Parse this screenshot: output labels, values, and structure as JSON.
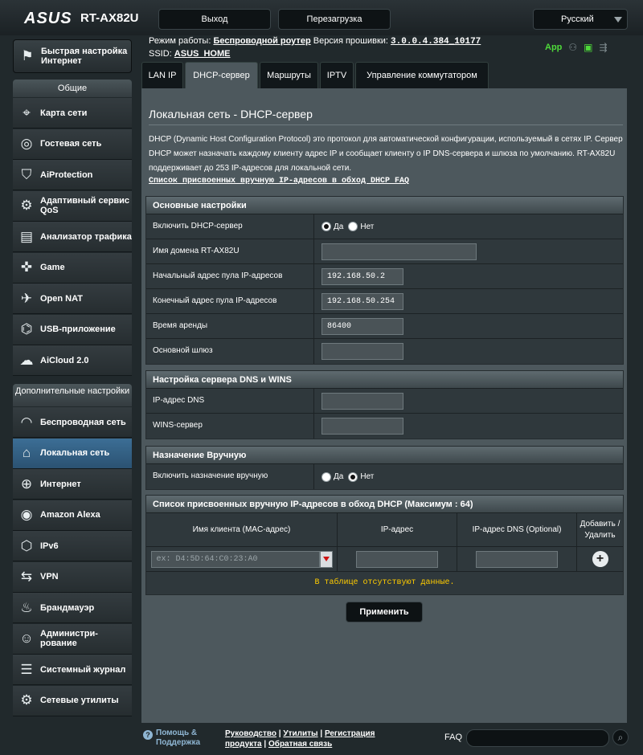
{
  "header": {
    "logo": "ASUS",
    "model": "RT-AX82U",
    "logout": "Выход",
    "reboot": "Перезагрузка",
    "language": "Русский"
  },
  "status": {
    "mode_label": "Режим работы:",
    "mode_value": "Беспроводной роутер",
    "fw_label": "Версия прошивки:",
    "fw_value": "3.0.0.4.384_10177",
    "ssid_label": "SSID:",
    "ssid_value": "ASUS_HOME",
    "app": "App"
  },
  "sidebar": {
    "quick_setup": "Быстрая настройка Интернет",
    "general_head": "Общие",
    "general": [
      {
        "label": "Карта сети",
        "icon": "network-map-icon",
        "glyph": "⌖"
      },
      {
        "label": "Гостевая сеть",
        "icon": "guest-network-icon",
        "glyph": "◎"
      },
      {
        "label": "AiProtection",
        "icon": "shield-icon",
        "glyph": "⛉"
      },
      {
        "label": "Адаптивный сервис QoS",
        "icon": "qos-icon",
        "glyph": "⚙"
      },
      {
        "label": "Анализатор трафика",
        "icon": "traffic-analyzer-icon",
        "glyph": "▤"
      },
      {
        "label": "Game",
        "icon": "gamepad-icon",
        "glyph": "✜"
      },
      {
        "label": "Open NAT",
        "icon": "open-nat-icon",
        "glyph": "✈"
      },
      {
        "label": "USB-приложение",
        "icon": "usb-icon",
        "glyph": "⌬"
      },
      {
        "label": "AiCloud 2.0",
        "icon": "cloud-icon",
        "glyph": "☁"
      }
    ],
    "advanced_head": "Дополнительные настройки",
    "advanced": [
      {
        "label": "Беспроводная сеть",
        "icon": "wireless-icon",
        "glyph": "◠"
      },
      {
        "label": "Локальная сеть",
        "icon": "lan-icon",
        "glyph": "⌂"
      },
      {
        "label": "Интернет",
        "icon": "globe-icon",
        "glyph": "⊕"
      },
      {
        "label": "Amazon Alexa",
        "icon": "alexa-icon",
        "glyph": "◉"
      },
      {
        "label": "IPv6",
        "icon": "ipv6-icon",
        "glyph": "⬡"
      },
      {
        "label": "VPN",
        "icon": "vpn-icon",
        "glyph": "⇆"
      },
      {
        "label": "Брандмауэр",
        "icon": "firewall-icon",
        "glyph": "♨"
      },
      {
        "label": "Администри-рование",
        "icon": "administration-icon",
        "glyph": "☺"
      },
      {
        "label": "Системный журнал",
        "icon": "system-log-icon",
        "glyph": "☰"
      },
      {
        "label": "Сетевые утилиты",
        "icon": "network-tools-icon",
        "glyph": "⚙"
      }
    ]
  },
  "tabs": [
    "LAN IP",
    "DHCP-сервер",
    "Маршруты",
    "IPTV",
    "Управление коммутатором"
  ],
  "page": {
    "title": "Локальная сеть - DHCP-сервер",
    "description": "DHCP (Dynamic Host Configuration Protocol) это протокол для автоматической конфигурации, используемый в сетях IP. Сервер DHCP может назначать каждому клиенту адрес IP и сообщает клиенту о IP DNS-сервера и шлюза по умолчанию. RT-AX82U поддерживает до 253 IP-адресов для локальной сети.",
    "link": "Список присвоенных вручную IP-адресов в обход DHCP FAQ"
  },
  "basic": {
    "title": "Основные настройки",
    "enable_label": "Включить DHCP-сервер",
    "yes": "Да",
    "no": "Нет",
    "domain_label": "Имя домена RT-AX82U",
    "domain_value": "",
    "start_label": "Начальный адрес пула IP-адресов",
    "start_value": "192.168.50.2",
    "end_label": "Конечный адрес пула IP-адресов",
    "end_value": "192.168.50.254",
    "lease_label": "Время аренды",
    "lease_value": "86400",
    "gw_label": "Основной шлюз",
    "gw_value": ""
  },
  "dns": {
    "title": "Настройка сервера DNS и WINS",
    "dns_label": "IP-адрес DNS",
    "dns_value": "",
    "wins_label": "WINS-сервер",
    "wins_value": ""
  },
  "manual": {
    "title": "Назначение Вручную",
    "enable_label": "Включить назначение вручную",
    "yes": "Да",
    "no": "Нет"
  },
  "list": {
    "title": "Список присвоенных вручную IP-адресов в обход DHCP (Максимум : 64)",
    "col_client": "Имя клиента (MAC-адрес)",
    "col_ip": "IP-адрес",
    "col_dns": "IP-адрес DNS (Optional)",
    "col_action": "Добавить / Удалить",
    "mac_placeholder": "ex: D4:5D:64:C0:23:A0",
    "empty": "В таблице отсутствуют данные."
  },
  "apply": "Применить",
  "footer": {
    "help": "Помощь & Поддержка",
    "manual": "Руководство",
    "utils": "Утилиты",
    "reg": "Регистрация",
    "prod": "продукта",
    "feedback": "Обратная связь",
    "faq": "FAQ"
  }
}
